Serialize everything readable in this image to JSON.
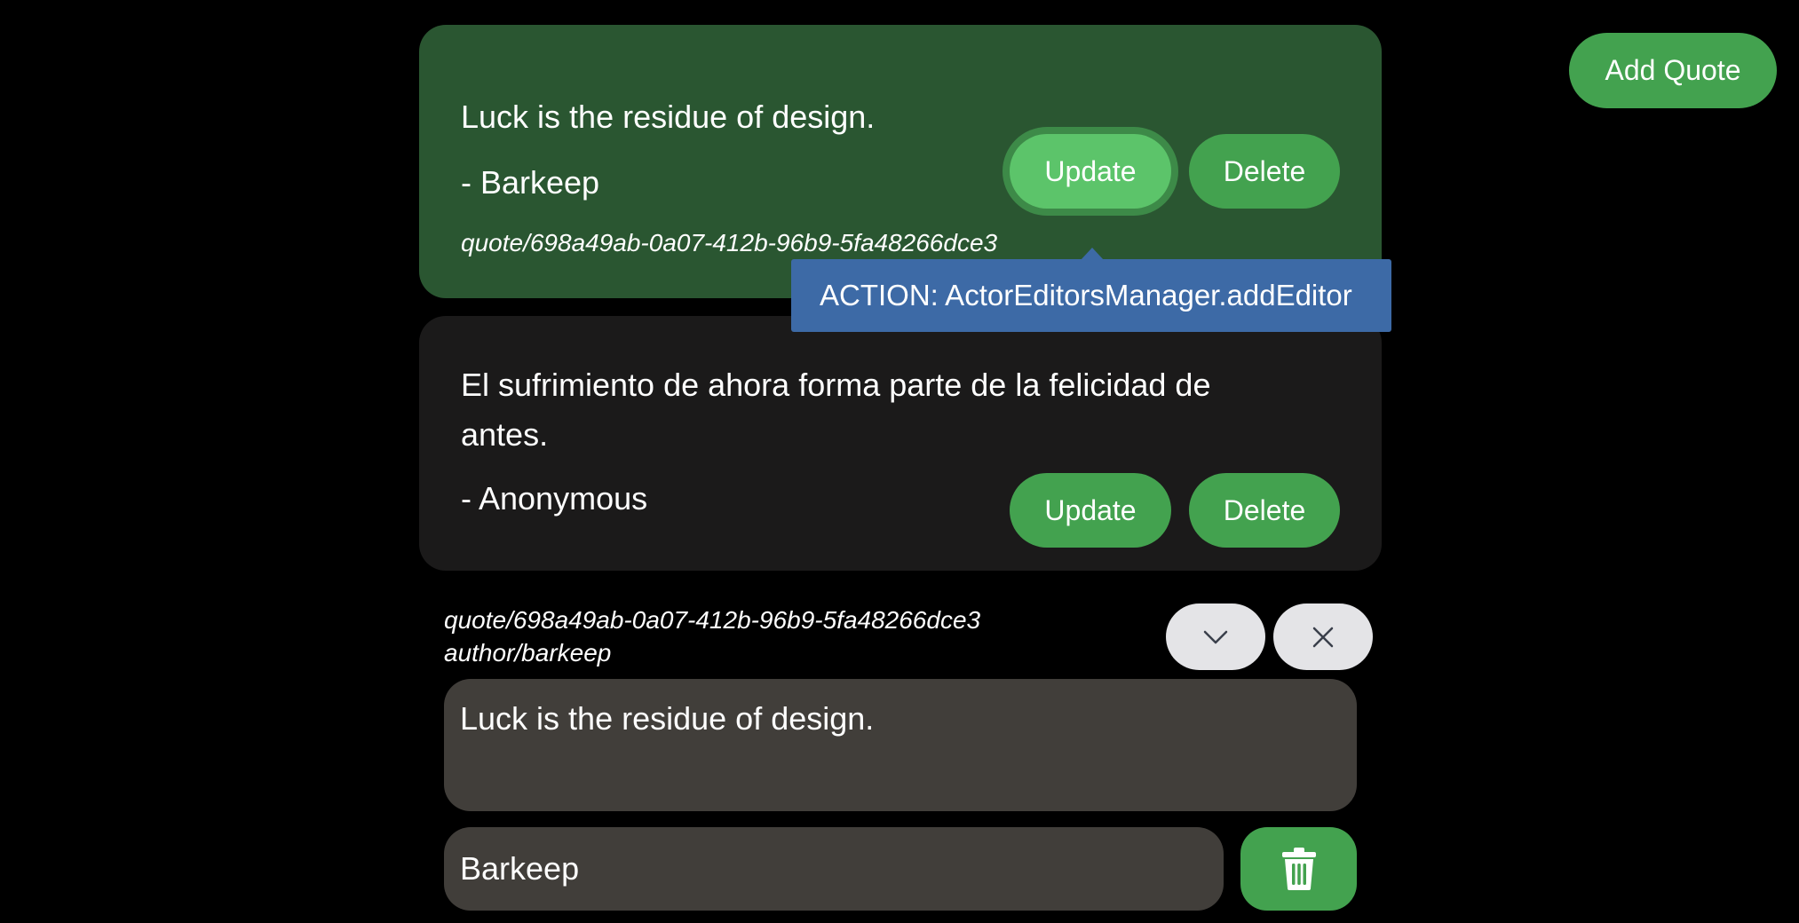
{
  "header": {
    "add_quote_label": "Add Quote"
  },
  "quotes": [
    {
      "text": "Luck is the residue of design.",
      "author": "- Barkeep",
      "id": "quote/698a49ab-0a07-412b-96b9-5fa48266dce3",
      "update_label": "Update",
      "delete_label": "Delete"
    },
    {
      "text": "El sufrimiento de ahora forma parte de la felicidad de antes.",
      "author": "- Anonymous",
      "update_label": "Update",
      "delete_label": "Delete"
    }
  ],
  "tooltip": {
    "text": "ACTION: ActorEditorsManager.addEditor"
  },
  "editor": {
    "quote_path": "quote/698a49ab-0a07-412b-96b9-5fa48266dce3",
    "author_path": "author/barkeep",
    "quote_value": "Luck is the residue of design.",
    "author_value": "Barkeep",
    "collapse_icon": "chevron-down-icon",
    "close_icon": "close-icon",
    "delete_icon": "trash-icon"
  },
  "colors": {
    "background": "#000000",
    "accent_green": "#43a24f",
    "active_card": "#2a5631",
    "card": "#1b1a1a",
    "tooltip": "#3d6aa6",
    "field": "#413e3a",
    "icon_button": "#e4e4e7"
  }
}
